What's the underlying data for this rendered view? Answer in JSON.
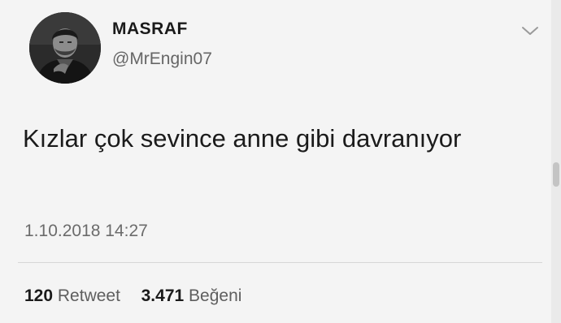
{
  "tweet": {
    "display_name": "MASRAF",
    "handle": "@MrEngin07",
    "text": "Kızlar çok sevince anne gibi davranıyor",
    "timestamp": "1.10.2018 14:27",
    "menu_icon": "chevron-down-icon"
  },
  "stats": {
    "retweet_count": "120",
    "retweet_label": "Retweet",
    "like_count": "3.471",
    "like_label": "Beğeni"
  },
  "colors": {
    "background": "#f4f4f4",
    "text": "#1b1b1b",
    "secondary_text": "#666666",
    "divider": "#d6d6d6"
  }
}
